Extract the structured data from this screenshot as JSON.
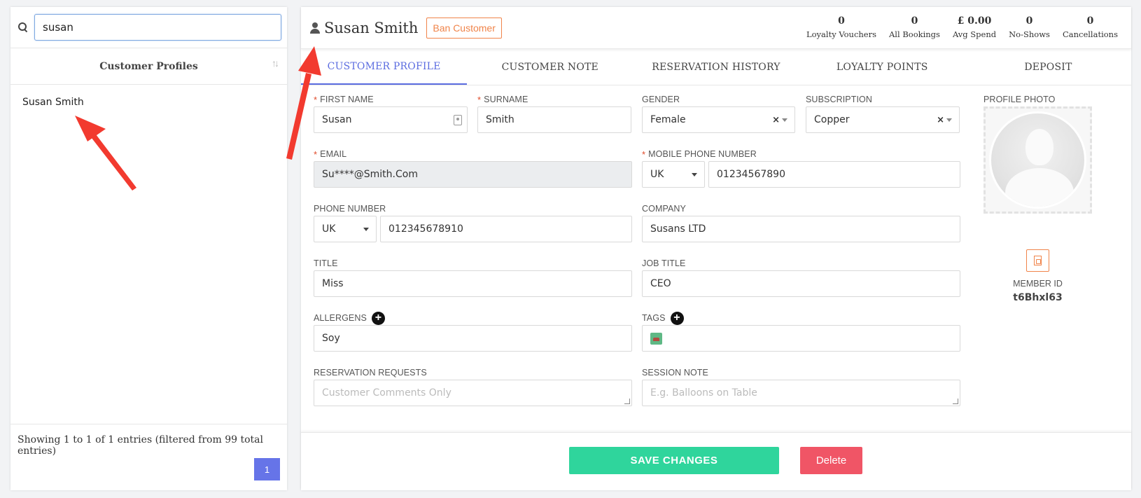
{
  "search": {
    "value": "susan"
  },
  "list": {
    "title": "Customer Profiles",
    "items": [
      {
        "name": "Susan Smith"
      }
    ],
    "footer_info": "Showing 1 to 1 of 1 entries (filtered from 99 total entries)",
    "page": "1"
  },
  "header": {
    "customer_name": "Susan Smith",
    "ban_label": "Ban Customer",
    "stats": [
      {
        "value": "0",
        "label": "Loyalty Vouchers"
      },
      {
        "value": "0",
        "label": "All Bookings"
      },
      {
        "value": "£ 0.00",
        "label": "Avg Spend"
      },
      {
        "value": "0",
        "label": "No-Shows"
      },
      {
        "value": "0",
        "label": "Cancellations"
      }
    ]
  },
  "tabs": [
    {
      "label": "CUSTOMER PROFILE",
      "active": true
    },
    {
      "label": "CUSTOMER NOTE"
    },
    {
      "label": "RESERVATION HISTORY"
    },
    {
      "label": "LOYALTY POINTS"
    },
    {
      "label": "DEPOSIT"
    }
  ],
  "form": {
    "first_name": {
      "label": "FIRST NAME",
      "value": "Susan"
    },
    "surname": {
      "label": "SURNAME",
      "value": "Smith"
    },
    "gender": {
      "label": "GENDER",
      "value": "Female"
    },
    "subscription": {
      "label": "SUBSCRIPTION",
      "value": "Copper"
    },
    "email": {
      "label": "EMAIL",
      "value": "Su****@Smith.Com"
    },
    "mobile": {
      "label": "MOBILE PHONE NUMBER",
      "country": "UK",
      "value": "01234567890"
    },
    "phone": {
      "label": "PHONE NUMBER",
      "country": "UK",
      "value": "012345678910"
    },
    "company": {
      "label": "COMPANY",
      "value": "Susans LTD"
    },
    "title": {
      "label": "TITLE",
      "value": "Miss"
    },
    "job_title": {
      "label": "JOB TITLE",
      "value": "CEO"
    },
    "allergens": {
      "label": "ALLERGENS",
      "value": "Soy"
    },
    "tags": {
      "label": "TAGS"
    },
    "reservation_requests": {
      "label": "RESERVATION REQUESTS",
      "placeholder": "Customer Comments Only"
    },
    "session_note": {
      "label": "SESSION NOTE",
      "placeholder": "E.g. Balloons on Table"
    },
    "clear_mark": "×"
  },
  "photo": {
    "label": "PROFILE PHOTO",
    "member_label": "MEMBER ID",
    "member_id": "t6Bhxl63"
  },
  "footer": {
    "save_label": "SAVE CHANGES",
    "delete_label": "Delete"
  },
  "colors": {
    "accent": "#5b6ce0",
    "save": "#2fd59c",
    "delete": "#f05566",
    "ban": "#f0844a",
    "annotation": "#f23a2f"
  }
}
